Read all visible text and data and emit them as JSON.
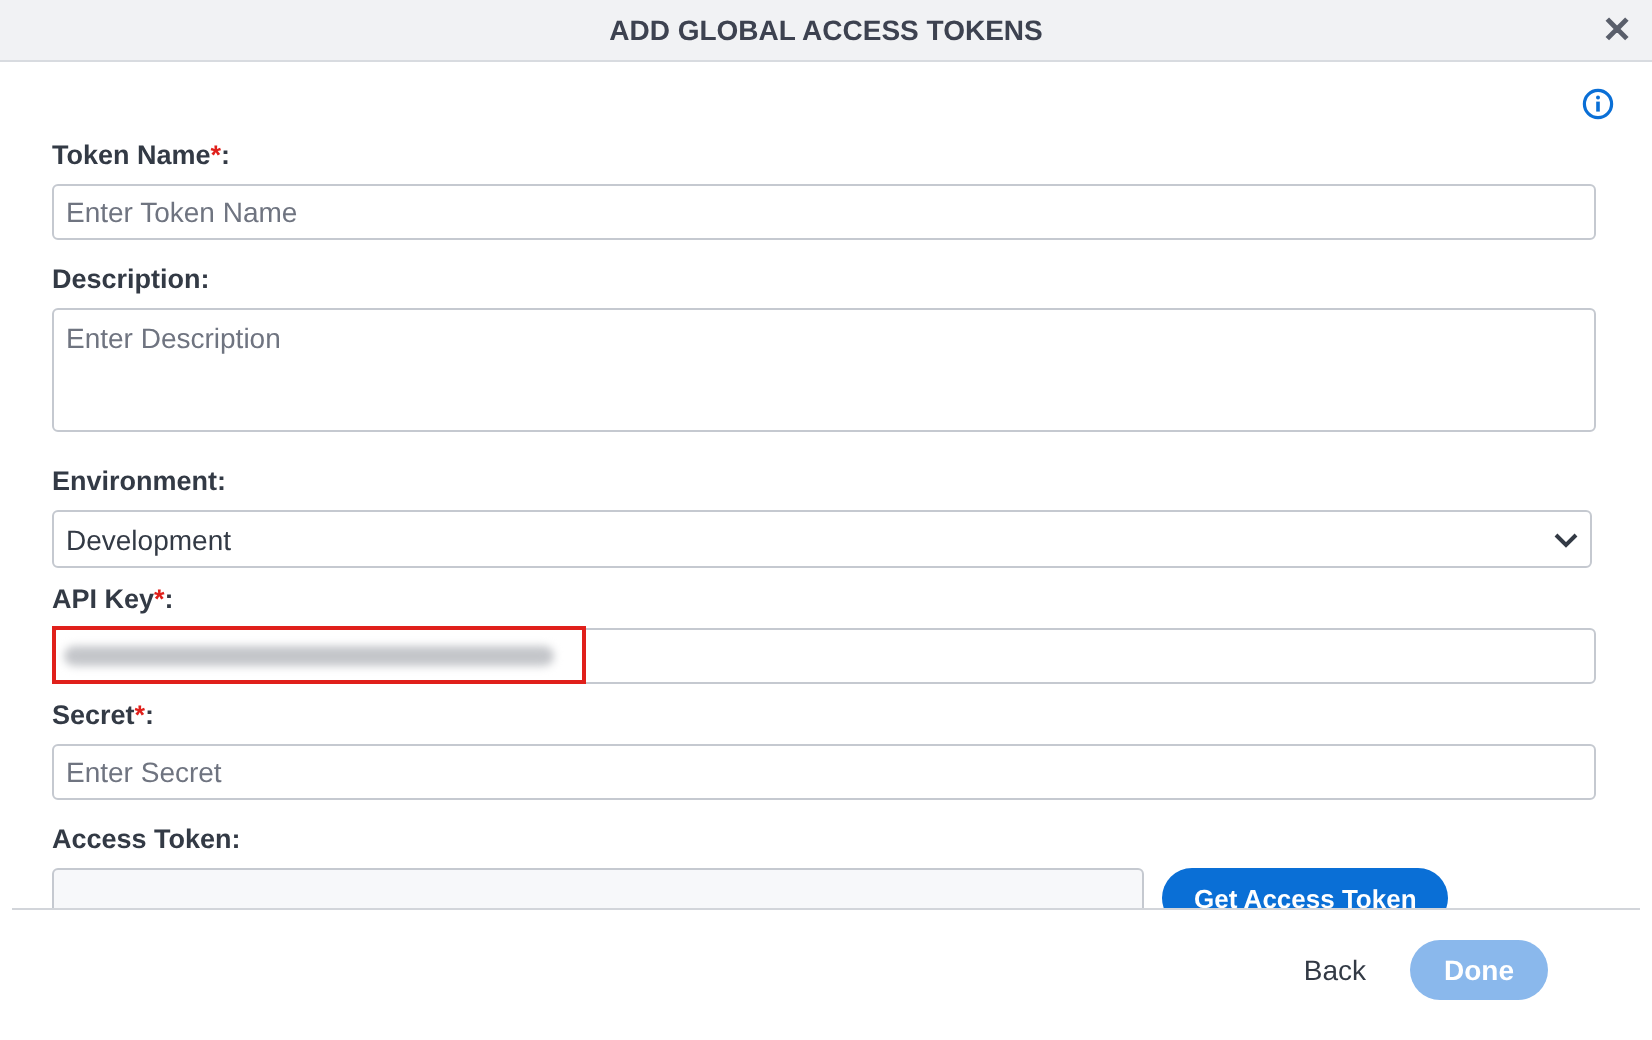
{
  "dialog": {
    "title": "ADD GLOBAL ACCESS TOKENS",
    "close_icon": "✕"
  },
  "fields": [
    {
      "kind": "input",
      "label": "Token Name",
      "required_mark": "*",
      "suffix": ":",
      "placeholder": "Enter Token Name"
    },
    {
      "kind": "textarea",
      "label": "Description",
      "suffix": ":",
      "placeholder": "Enter Description"
    },
    {
      "kind": "select",
      "label": "Environment",
      "suffix": ":",
      "value": "Development"
    },
    {
      "kind": "redacted",
      "label": "API Key",
      "required_mark": "*",
      "suffix": ":",
      "highlighted": true
    },
    {
      "kind": "input",
      "label": "Secret",
      "required_mark": "*",
      "suffix": ":",
      "placeholder": "Enter Secret"
    },
    {
      "kind": "token",
      "label": "Access Token",
      "suffix": ":",
      "button": "Get Access Token"
    }
  ],
  "footer": {
    "buttons": [
      {
        "label": "Back",
        "kind": "text",
        "disabled": false
      },
      {
        "label": "Done",
        "kind": "primary",
        "disabled": true
      }
    ]
  }
}
